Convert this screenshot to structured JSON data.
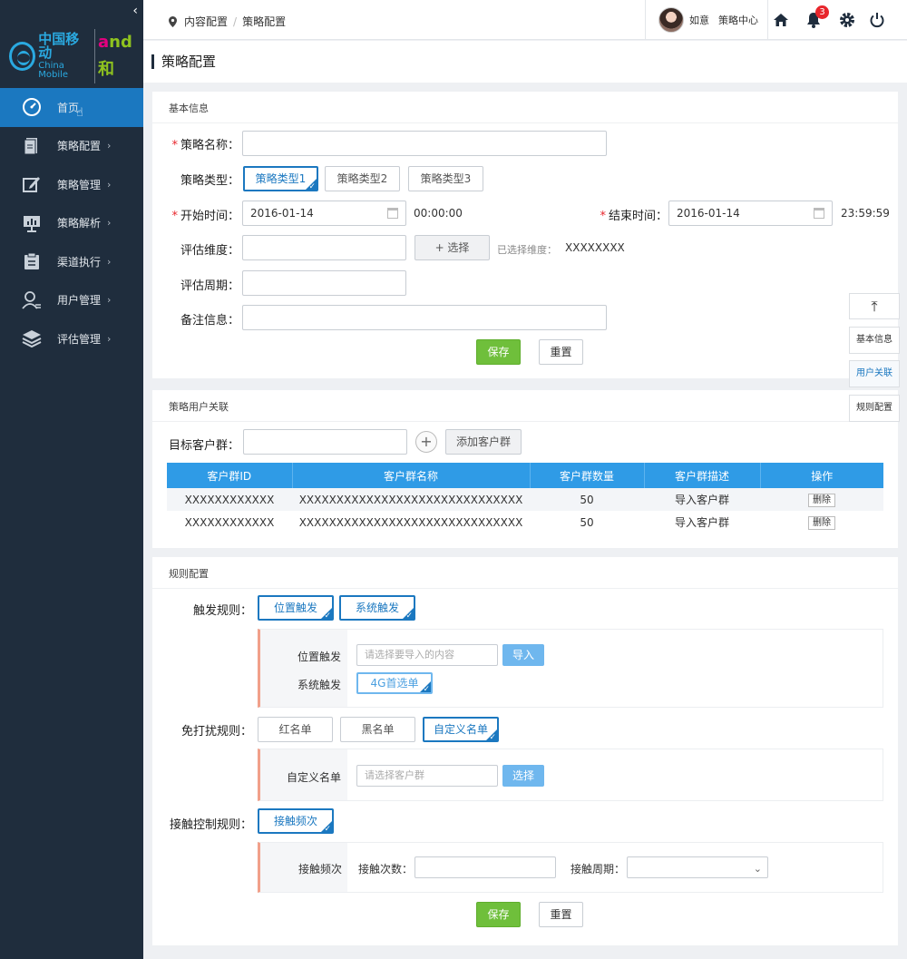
{
  "brand": {
    "cn": "中国移动",
    "en": "China Mobile",
    "and_a": "a",
    "and_nd": "nd",
    "and_he": "和"
  },
  "sidebar": {
    "collapse_glyph": "‹",
    "items": [
      {
        "label": "首页",
        "icon": "dashboard-icon",
        "arrow": ""
      },
      {
        "label": "策略配置",
        "icon": "document-icon",
        "arrow": "›"
      },
      {
        "label": "策略管理",
        "icon": "edit-icon",
        "arrow": "›"
      },
      {
        "label": "策略解析",
        "icon": "presentation-icon",
        "arrow": "›"
      },
      {
        "label": "渠道执行",
        "icon": "clipboard-icon",
        "arrow": "›"
      },
      {
        "label": "用户管理",
        "icon": "user-icon",
        "arrow": "›"
      },
      {
        "label": "评估管理",
        "icon": "layers-icon",
        "arrow": "›"
      }
    ],
    "active_index": 0
  },
  "header": {
    "breadcrumb": [
      "内容配置",
      "策略配置"
    ],
    "breadcrumb_sep": "/",
    "user_name": "如意",
    "user_role": "策略中心",
    "notification_count": "3"
  },
  "page": {
    "title": "策略配置"
  },
  "basic": {
    "section_title": "基本信息",
    "name_label": "策略名称：",
    "type_label": "策略类型：",
    "types": [
      "策略类型1",
      "策略类型2",
      "策略类型3"
    ],
    "start_label": "开始时间：",
    "start_date": "2016-01-14",
    "start_time": "00:00:00",
    "end_label": "结束时间：",
    "end_date": "2016-01-14",
    "end_time": "23:59:59",
    "dim_label": "评估维度：",
    "dim_button": "+ 选择",
    "dim_selected_label": "已选择维度：",
    "dim_selected_value": "XXXXXXXX",
    "period_label": "评估周期：",
    "remark_label": "备注信息：",
    "save": "保存",
    "reset": "重置"
  },
  "user_link": {
    "section_title": "策略用户关联",
    "target_label": "目标客户群：",
    "plus_glyph": "+",
    "add_button": "添加客户群",
    "columns": [
      "客户群ID",
      "客户群名称",
      "客户群数量",
      "客户群描述",
      "操作"
    ],
    "rows": [
      {
        "id": "XXXXXXXXXXXX",
        "name": "XXXXXXXXXXXXXXXXXXXXXXXXXXXXXX",
        "count": "50",
        "desc": "导入客户群",
        "op": "删除"
      },
      {
        "id": "XXXXXXXXXXXX",
        "name": "XXXXXXXXXXXXXXXXXXXXXXXXXXXXXX",
        "count": "50",
        "desc": "导入客户群",
        "op": "删除"
      }
    ]
  },
  "rules": {
    "section_title": "规则配置",
    "trigger_label": "触发规则：",
    "trigger_options": [
      "位置触发",
      "系统触发"
    ],
    "loc_label": "位置触发",
    "loc_placeholder": "请选择要导入的内容",
    "loc_button": "导入",
    "sys_label": "系统触发",
    "sys_option": "4G首选单",
    "dnd_label": "免打扰规则：",
    "dnd_options": [
      "红名单",
      "黑名单",
      "自定义名单"
    ],
    "custom_label": "自定义名单",
    "custom_placeholder": "请选择客户群",
    "custom_button": "选择",
    "contact_label": "接触控制规则：",
    "contact_option": "接触频次",
    "freq_label": "接触频次",
    "count_label": "接触次数：",
    "period_label": "接触周期：",
    "save": "保存",
    "reset": "重置"
  },
  "float_nav": {
    "top_glyph": "⤒",
    "items": [
      "基本信息",
      "用户关联",
      "规则配置"
    ],
    "active_index": 1
  },
  "colors": {
    "sidebar_bg": "#1f2d3d",
    "accent_blue": "#1b78c0",
    "table_head": "#2f9be6",
    "save_green": "#6fbf3b"
  }
}
